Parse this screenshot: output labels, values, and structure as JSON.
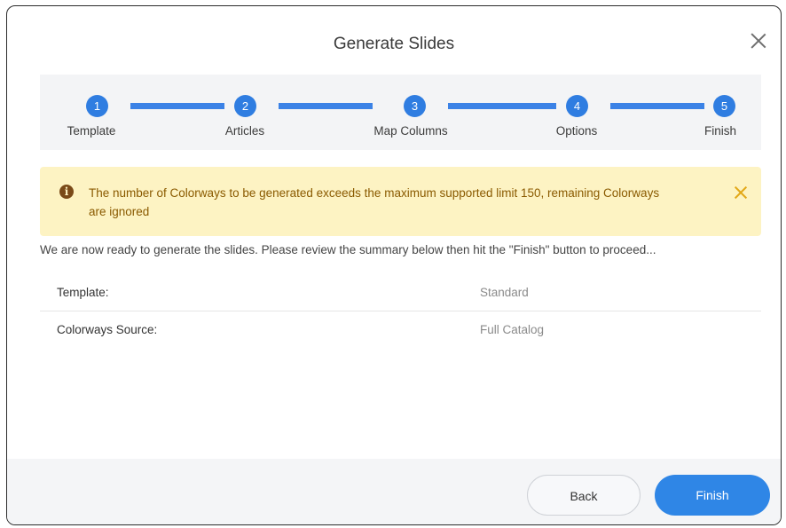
{
  "dialog": {
    "title": "Generate Slides"
  },
  "stepper": {
    "steps": [
      {
        "number": "1",
        "label": "Template"
      },
      {
        "number": "2",
        "label": "Articles"
      },
      {
        "number": "3",
        "label": "Map Columns"
      },
      {
        "number": "4",
        "label": "Options"
      },
      {
        "number": "5",
        "label": "Finish"
      }
    ]
  },
  "warning": {
    "icon": "info-icon",
    "message": "The number of Colorways to be generated exceeds the maximum supported limit 150, remaining Colorways are ignored"
  },
  "intro": "We are now ready to generate the slides. Please review the summary below then hit the \"Finish\" button to proceed...",
  "summary": [
    {
      "key": "Template:",
      "value": "Standard"
    },
    {
      "key": "Colorways Source:",
      "value": "Full Catalog"
    }
  ],
  "footer": {
    "back_label": "Back",
    "finish_label": "Finish"
  },
  "colors": {
    "accent": "#2f7de1",
    "warning_bg": "#fdf3c3",
    "warning_text": "#8a5a00"
  }
}
